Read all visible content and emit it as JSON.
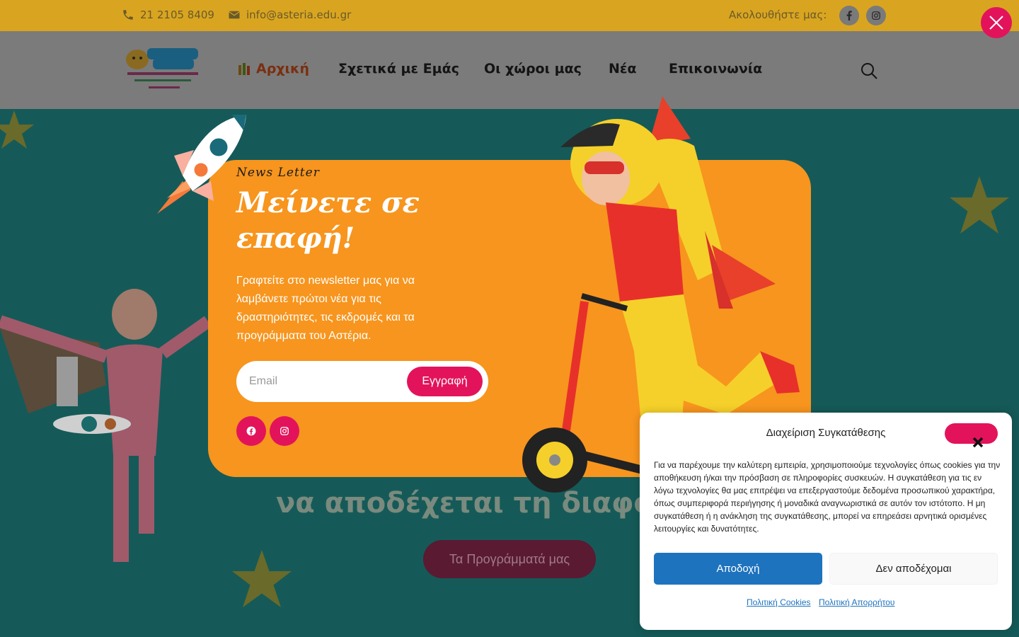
{
  "topbar": {
    "phone": "21 2105 8409",
    "email": "info@asteria.edu.gr",
    "follow_label": "Ακολουθήστε μας:",
    "social": [
      "facebook-icon",
      "instagram-icon"
    ]
  },
  "header": {
    "logo_alt": "Αστεριών Δράσεις",
    "nav": {
      "home": "Αρχική",
      "about": "Σχετικά με Εμάς",
      "spaces": "Οι χώροι μας",
      "news": "Νέα",
      "contact": "Επικοινωνία"
    },
    "search_icon": "search-icon"
  },
  "hero": {
    "headline_fragment": "να αποδέχεται τη διαφορετ",
    "cta": "Τα Προγράμματά μας"
  },
  "newsletter": {
    "kicker": "News Letter",
    "title": "Μείνετε σε επαφή!",
    "description": "Γραφτείτε στο newsletter μας για να λαμβάνετε πρώτοι νέα για τις δραστηριότητες, τις εκδρομές και τα προγράμματα του Αστέρια.",
    "email_placeholder": "Email",
    "subscribe": "Εγγραφή",
    "social": [
      "facebook-icon",
      "instagram-icon"
    ]
  },
  "consent": {
    "title": "Διαχείριση Συγκατάθεσης",
    "body": "Για να παρέχουμε την καλύτερη εμπειρία, χρησιμοποιούμε τεχνολογίες όπως cookies για την αποθήκευση ή/και την πρόσβαση σε πληροφορίες συσκευών. Η συγκατάθεση για τις εν λόγω τεχνολογίες θα μας επιτρέψει να επεξεργαστούμε δεδομένα προσωπικού χαρακτήρα, όπως συμπεριφορά περιήγησης ή μοναδικά αναγνωριστικά σε αυτόν τον ιστότοπο. Η μη συγκατάθεση ή η ανάκληση της συγκατάθεσης, μπορεί να επηρεάσει αρνητικά ορισμένες λειτουργίες και δυνατότητες.",
    "accept": "Αποδοχή",
    "deny": "Δεν αποδέχομαι",
    "link_cookies": "Πολιτική Cookies",
    "link_privacy": "Πολιτική Απορρήτου"
  },
  "colors": {
    "accent": "#e3135b",
    "popup_bg": "#f7951e",
    "primary_button": "#1e73be",
    "topbar": "#d9a520"
  }
}
